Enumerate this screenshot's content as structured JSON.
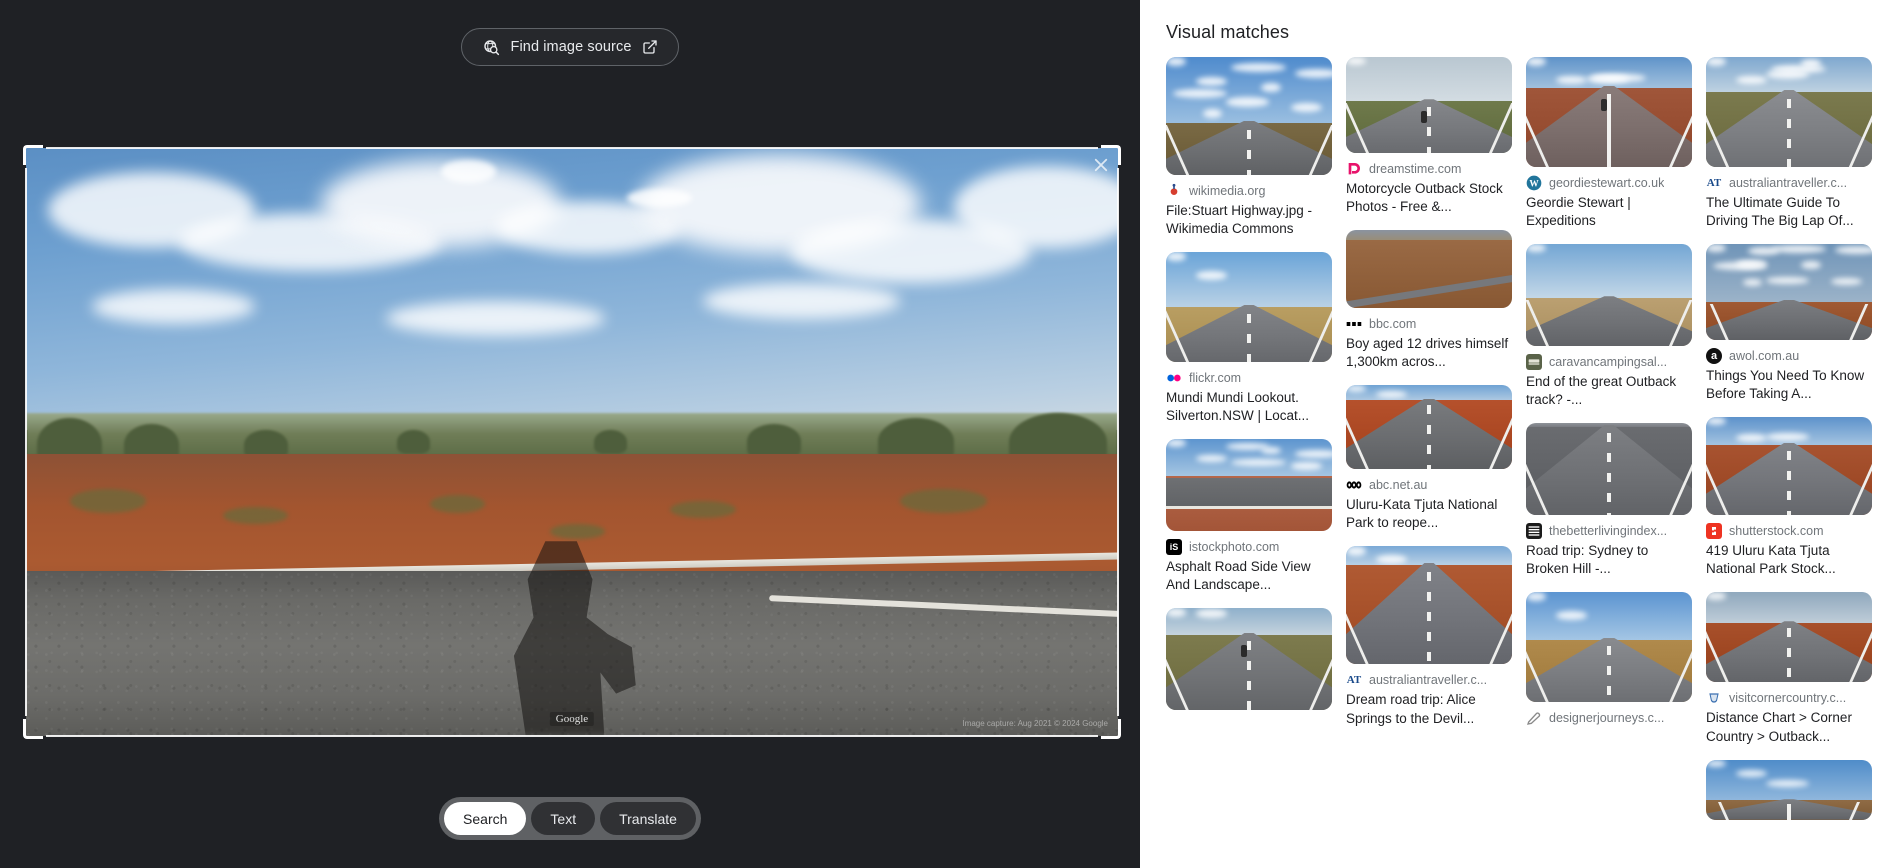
{
  "left_panel": {
    "find_image_source": {
      "label": "Find image source",
      "search_icon": "image-search-icon",
      "external_icon": "open-in-new-icon"
    },
    "image_viewer": {
      "close_icon": "close-icon",
      "watermark": "Google",
      "attribution": "Image capture: Aug 2021  © 2024 Google",
      "crop_handles": [
        "top-left",
        "top-right",
        "bottom-left",
        "bottom-right"
      ]
    },
    "mode_tabs": [
      {
        "label": "Search",
        "active": true
      },
      {
        "label": "Text",
        "active": false
      },
      {
        "label": "Translate",
        "active": false
      }
    ]
  },
  "right_panel": {
    "title": "Visual matches",
    "columns": [
      [
        {
          "source": "wikimedia.org",
          "favicon": "wikimedia-icon",
          "favicon_text": "",
          "favicon_bg": "#ffffff",
          "title": "File:Stuart Highway.jpg - Wikimedia Commons",
          "thumb_height": 118,
          "scene": "outback-road-from-car-blue-sky"
        },
        {
          "source": "flickr.com",
          "favicon": "flickr-icon",
          "favicon_text": "",
          "favicon_bg": "#ffffff",
          "title": "Mundi Mundi Lookout. Silverton.NSW | Locat...",
          "thumb_height": 110,
          "scene": "desert-road-curving-dry-grass"
        },
        {
          "source": "istockphoto.com",
          "favicon": "istock-icon",
          "favicon_text": "iS",
          "favicon_bg": "#000000",
          "title": "Asphalt Road Side View And Landscape...",
          "thumb_height": 92,
          "scene": "roadside-view-red-earth"
        },
        {
          "source": "",
          "favicon": "",
          "favicon_text": "",
          "favicon_bg": "#ffffff",
          "title": "",
          "thumb_height": 102,
          "scene": "cyclist-on-country-road"
        }
      ],
      [
        {
          "source": "dreamstime.com",
          "favicon": "dreamstime-icon",
          "favicon_text": "",
          "favicon_bg": "#ffffff",
          "title": "Motorcycle Outback Stock Photos - Free &...",
          "thumb_height": 96,
          "scene": "motorcycle-on-outback-highway"
        },
        {
          "source": "bbc.com",
          "favicon": "bbc-icon",
          "favicon_text": "",
          "favicon_bg": "#ffffff",
          "title": "Boy aged 12 drives himself 1,300km acros...",
          "thumb_height": 78,
          "scene": "aerial-outback-road-scrub"
        },
        {
          "source": "abc.net.au",
          "favicon": "abc-icon",
          "favicon_text": "",
          "favicon_bg": "#ffffff",
          "title": "Uluru-Kata Tjuta National Park to reope...",
          "thumb_height": 84,
          "scene": "red-desert-highway"
        },
        {
          "source": "australiantraveller.c...",
          "favicon": "australiantraveller-icon",
          "favicon_text": "AT",
          "favicon_bg": "#ffffff",
          "title": "Dream road trip: Alice Springs to the Devil...",
          "thumb_height": 118,
          "scene": "red-dirt-highway-straight"
        }
      ],
      [
        {
          "source": "geordiestewart.co.uk",
          "favicon": "wordpress-icon",
          "favicon_text": "",
          "favicon_bg": "#ffffff",
          "title": "Geordie Stewart | Expeditions",
          "thumb_height": 110,
          "scene": "red-road-trees-cyclist"
        },
        {
          "source": "caravancampingsal...",
          "favicon": "caravancamping-icon",
          "favicon_text": "",
          "favicon_bg": "#5a6349",
          "title": "End of the great Outback track? -...",
          "thumb_height": 102,
          "scene": "flat-desert-road-pale-sky"
        },
        {
          "source": "thebetterlivingindex...",
          "favicon": "thebetterlivingindex-icon",
          "favicon_text": "",
          "favicon_bg": "#1b1b1b",
          "title": "Road trip: Sydney to Broken Hill -...",
          "thumb_height": 92,
          "scene": "asphalt-close-up-highway"
        },
        {
          "source": "designerjourneys.c...",
          "favicon": "designerjourneys-icon",
          "favicon_text": "",
          "favicon_bg": "#ffffff",
          "title": "",
          "thumb_height": 110,
          "scene": "mesa-desert-road"
        }
      ],
      [
        {
          "source": "australiantraveller.c...",
          "favicon": "australiantraveller-icon",
          "favicon_text": "AT",
          "favicon_bg": "#ffffff",
          "title": "The Ultimate Guide To Driving The Big Lap Of...",
          "thumb_height": 110,
          "scene": "escarpment-road-green-scrub"
        },
        {
          "source": "awol.com.au",
          "favicon": "awol-icon",
          "favicon_text": "a",
          "favicon_bg": "#111111",
          "title": "Things You Need To Know Before Taking A...",
          "thumb_height": 96,
          "scene": "cloudy-sky-outback-road"
        },
        {
          "source": "shutterstock.com",
          "favicon": "shutterstock-icon",
          "favicon_text": "",
          "favicon_bg": "#ee3322",
          "title": "419 Uluru Kata Tjuta National Park Stock...",
          "thumb_height": 98,
          "scene": "red-centre-road-bend"
        },
        {
          "source": "visitcornercountry.c...",
          "favicon": "visitcornercountry-icon",
          "favicon_text": "",
          "favicon_bg": "#ffffff",
          "title": "Distance Chart > Corner Country > Outback...",
          "thumb_height": 90,
          "scene": "red-shoulder-straight-road"
        },
        {
          "source": "",
          "favicon": "",
          "favicon_text": "",
          "favicon_bg": "#ffffff",
          "title": "",
          "thumb_height": 60,
          "scene": "blue-sky-road"
        }
      ]
    ]
  },
  "colors": {
    "left_bg": "#1f2125",
    "right_bg": "#ffffff",
    "chip_active_bg": "#ffffff",
    "chip_bg": "#303134",
    "chip_track": "#5f6164",
    "text_primary": "#202124",
    "text_secondary": "#70757a",
    "button_border": "#5f6368"
  }
}
